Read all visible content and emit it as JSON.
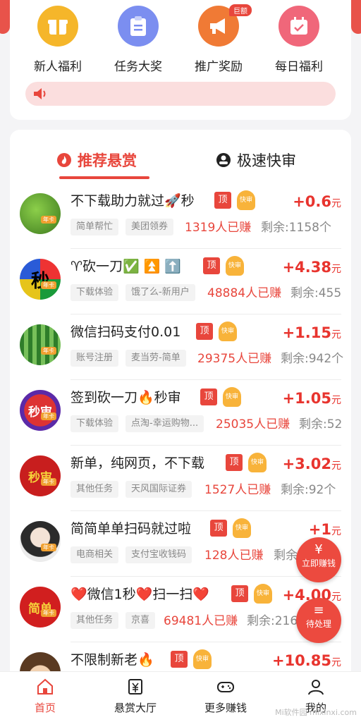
{
  "quick_actions": [
    {
      "label": "新人福利",
      "color": "#f5b62a"
    },
    {
      "label": "任务大奖",
      "color": "#7b8ef0"
    },
    {
      "label": "推广奖励",
      "color": "#f07a35",
      "badge": "巨额"
    },
    {
      "label": "每日福利",
      "color": "#f0677a"
    }
  ],
  "notice": {
    "icon": "speaker-icon",
    "text": ""
  },
  "tabs": {
    "recommended": "推荐悬赏",
    "fast_review": "极速快审"
  },
  "tasks": [
    {
      "title": "不下载助力就过🚀秒",
      "avatar_text": "",
      "price": "+0.6",
      "unit": "元",
      "tags": [
        "简单帮忙",
        "美团领券"
      ],
      "earned": "1319人已赚",
      "remaining": "剩余:1158个"
    },
    {
      "title": "♈砍一刀✅ ⏫ ⬆️",
      "avatar_text": "秒",
      "price": "+4.38",
      "unit": "元",
      "tags": [
        "下载体验",
        "饿了么-新用户"
      ],
      "earned": "48884人已赚",
      "remaining": "剩余:455"
    },
    {
      "title": "微信扫码支付0.01",
      "avatar_text": "",
      "price": "+1.15",
      "unit": "元",
      "tags": [
        "账号注册",
        "麦当劳-简单"
      ],
      "earned": "29375人已赚",
      "remaining": "剩余:942个"
    },
    {
      "title": "签到砍一刀🔥秒审",
      "avatar_text": "秒审",
      "price": "+1.05",
      "unit": "元",
      "tags": [
        "下载体验",
        "点淘-幸运购物..."
      ],
      "earned": "25035人已赚",
      "remaining": "剩余:52"
    },
    {
      "title": "新单，纯网页，不下载",
      "avatar_text": "秒审",
      "price": "+3.02",
      "unit": "元",
      "tags": [
        "其他任务",
        "天风国际证券"
      ],
      "earned": "1527人已赚",
      "remaining": "剩余:92个"
    },
    {
      "title": "简简单单扫码就过啦",
      "avatar_text": "",
      "price": "+1",
      "unit": "元",
      "tags": [
        "电商相关",
        "支付宝收钱码"
      ],
      "earned": "128人已赚",
      "remaining": "剩余"
    },
    {
      "title": "❤️微信1秒❤️扫一扫❤️",
      "avatar_text": "简单",
      "price": "+4.00",
      "unit": "元",
      "tags": [
        "其他任务",
        "京喜"
      ],
      "earned": "69481人已赚",
      "remaining": "剩余:216"
    },
    {
      "title": "不限制新老🔥",
      "avatar_text": "",
      "price": "+10.85",
      "unit": "元",
      "tags": [],
      "earned": "",
      "remaining": ""
    }
  ],
  "task_pill_top": "顶",
  "task_pill_fast": "快审",
  "avatar_tag": "年卡",
  "floating": {
    "earn_now": {
      "icon": "¥",
      "label": "立即赚钱"
    },
    "pending": {
      "icon": "≡",
      "label": "待处理"
    }
  },
  "tabbar": [
    {
      "label": "首页",
      "icon": "home-icon",
      "active": true
    },
    {
      "label": "悬赏大厅",
      "icon": "yen-doc-icon",
      "active": false
    },
    {
      "label": "更多赚钱",
      "icon": "gamepad-icon",
      "active": false
    },
    {
      "label": "我的",
      "icon": "user-icon",
      "active": false
    }
  ],
  "watermark": "Mi软件园 mixinxi.com",
  "colors": {
    "accent": "#e8463c",
    "price": "#e8342e"
  }
}
